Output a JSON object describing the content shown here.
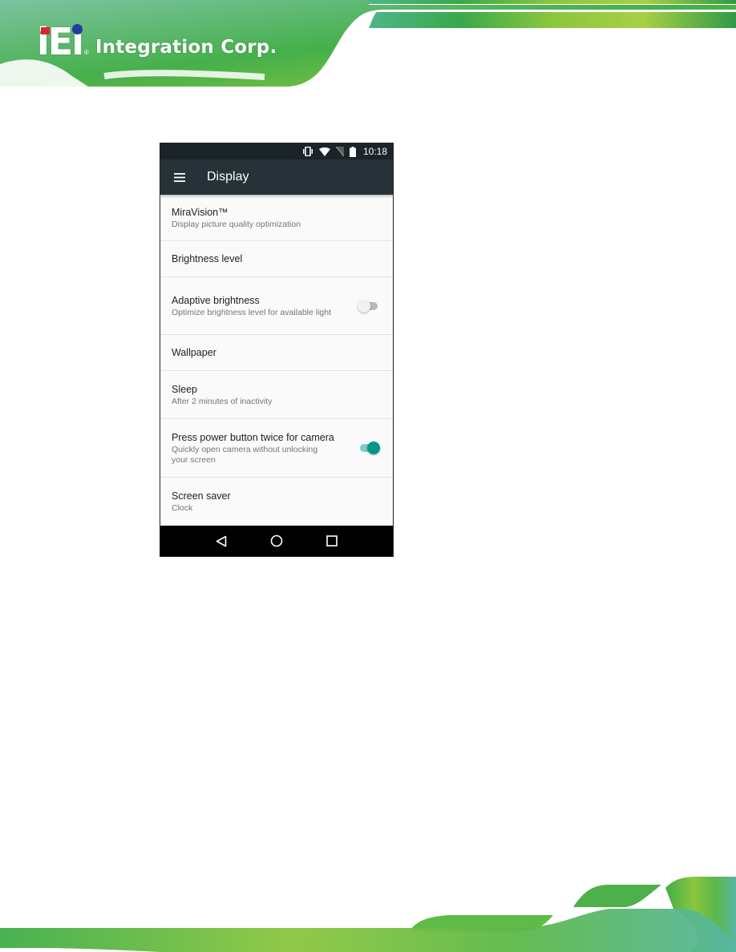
{
  "brand": {
    "logo_mark": "iEi",
    "logo_text": "Integration Corp.",
    "colors": {
      "banner_green": "#3fae49",
      "banner_lime": "#a6d13a",
      "logo_red": "#d9262e",
      "logo_blue": "#1f3f9f"
    }
  },
  "phone": {
    "status_bar": {
      "icons": [
        "vibrate-icon",
        "wifi-icon",
        "no-sim-icon",
        "battery-icon"
      ],
      "time": "10:18"
    },
    "app_bar": {
      "menu_icon": "hamburger-menu-icon",
      "title": "Display"
    },
    "settings": [
      {
        "title": "MiraVision™",
        "subtitle": "Display picture quality optimization"
      },
      {
        "title": "Brightness level"
      },
      {
        "title": "Adaptive brightness",
        "subtitle": "Optimize brightness level for available light",
        "toggle": "off"
      },
      {
        "title": "Wallpaper"
      },
      {
        "title": "Sleep",
        "subtitle": "After 2 minutes of inactivity"
      },
      {
        "title": "Press power button twice for camera",
        "subtitle": "Quickly open camera without unlocking your screen",
        "toggle": "on"
      },
      {
        "title": "Screen saver",
        "subtitle": "Clock"
      }
    ],
    "nav_bar": {
      "buttons": [
        "back-icon",
        "home-icon",
        "recents-icon"
      ]
    },
    "colors": {
      "status_bar": "#1b2428",
      "app_bar": "#263238",
      "accent": "#009688",
      "accent_track": "#80cbc4",
      "background": "#fafafa"
    }
  }
}
